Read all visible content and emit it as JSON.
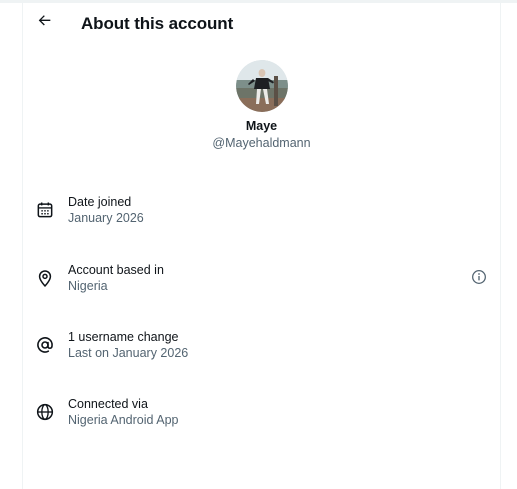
{
  "header": {
    "title": "About this account",
    "back_icon": "arrow-left-icon"
  },
  "profile": {
    "display_name": "Maye",
    "handle": "@Mayehaldmann"
  },
  "details": [
    {
      "icon": "calendar-icon",
      "label": "Date joined",
      "value": "January 2026"
    },
    {
      "icon": "location-pin-icon",
      "label": "Account based in",
      "value": "Nigeria",
      "trailing_icon": "info-icon"
    },
    {
      "icon": "at-sign-icon",
      "label": "1 username change",
      "value": "Last on January 2026"
    },
    {
      "icon": "globe-icon",
      "label": "Connected via",
      "value": "Nigeria Android App"
    }
  ],
  "colors": {
    "primary_text": "#0f1419",
    "secondary_text": "#536471",
    "border": "#eff3f4"
  }
}
